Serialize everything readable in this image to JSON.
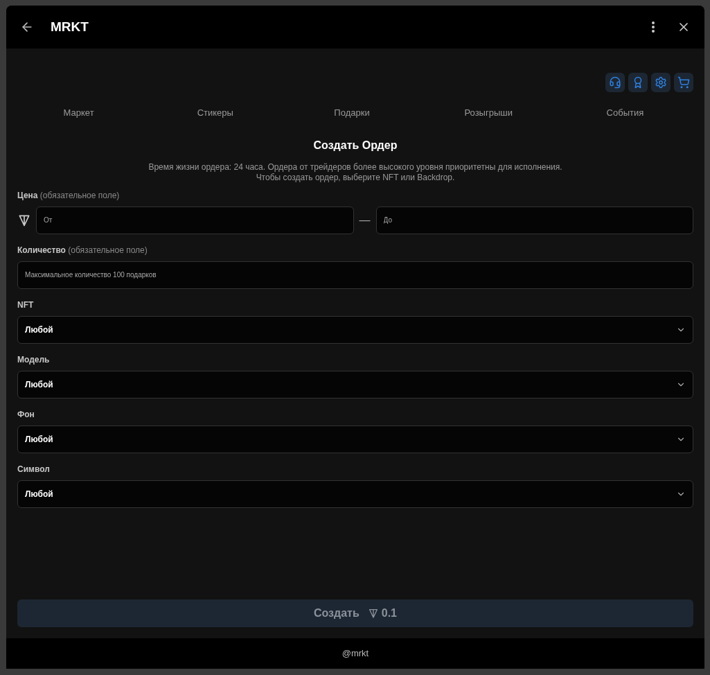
{
  "window": {
    "title": "MRKT"
  },
  "tabs": [
    {
      "label": "Маркет"
    },
    {
      "label": "Стикеры"
    },
    {
      "label": "Подарки"
    },
    {
      "label": "Розыгрыши"
    },
    {
      "label": "События"
    }
  ],
  "form": {
    "title": "Создать Ордер",
    "description": [
      "Время жизни ордера: 24 часа. Ордера от трейдеров более высокого уровня приоритетны для исполнения.",
      "Чтобы создать ордер, выберите NFT или Backdrop."
    ],
    "price": {
      "label": "Цена",
      "hint": "(обязательное поле)",
      "from_placeholder": "От",
      "to_placeholder": "До",
      "separator": "—"
    },
    "quantity": {
      "label": "Количество",
      "hint": "(обязательное поле)",
      "placeholder": "Максимальное количество 100 подарков"
    },
    "selects": [
      {
        "label": "NFT",
        "value": "Любой"
      },
      {
        "label": "Модель",
        "value": "Любой"
      },
      {
        "label": "Фон",
        "value": "Любой"
      },
      {
        "label": "Символ",
        "value": "Любой"
      }
    ],
    "submit": {
      "label": "Создать",
      "price": "0.1",
      "disabled": true
    }
  },
  "footer": "@mrkt"
}
